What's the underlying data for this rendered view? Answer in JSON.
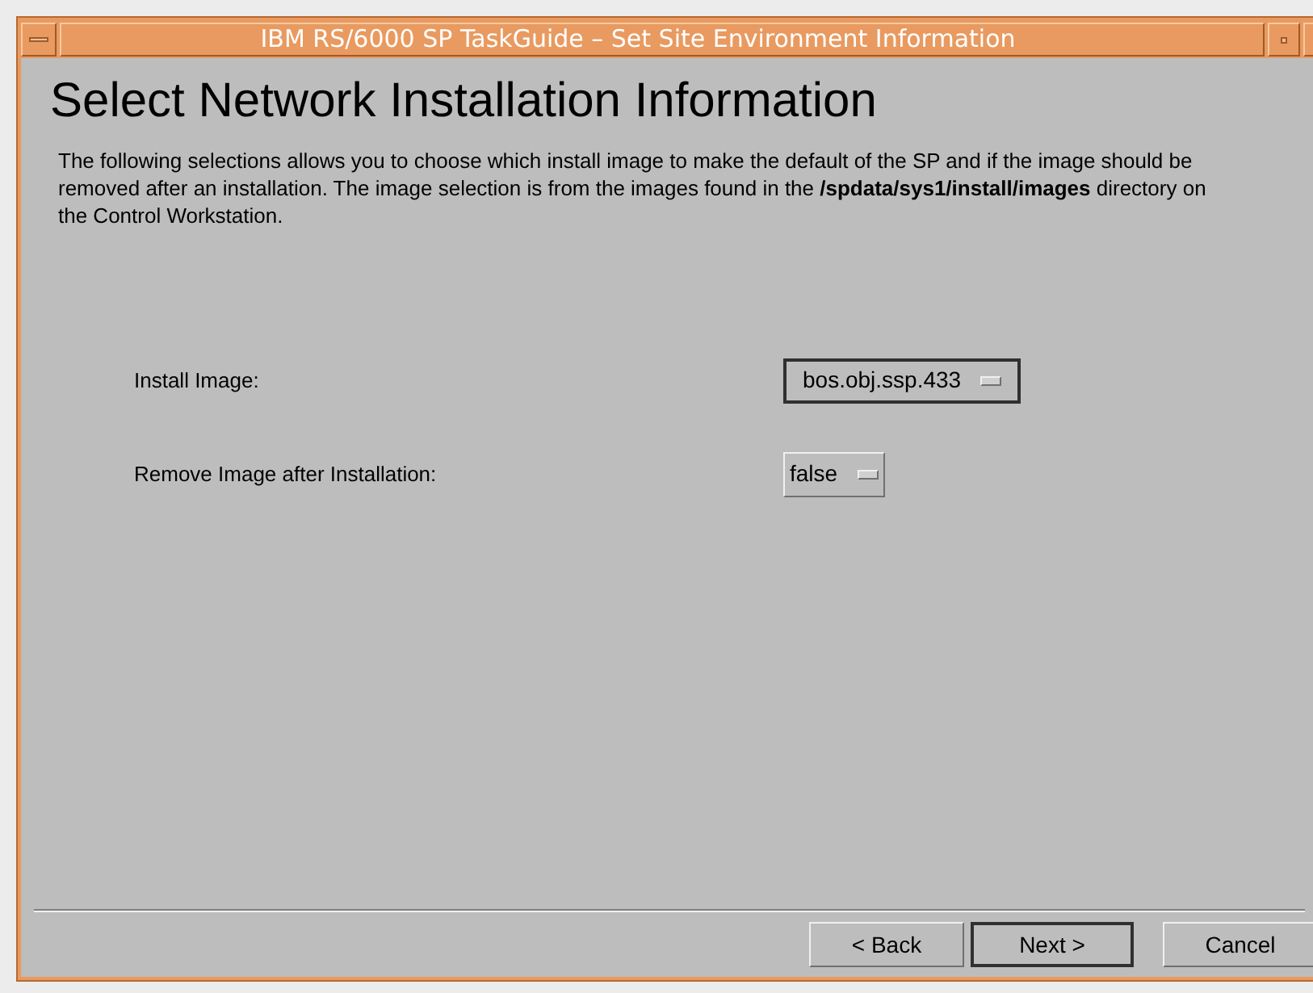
{
  "window": {
    "title": "IBM RS/6000 SP TaskGuide – Set Site Environment Information"
  },
  "heading": "Select Network Installation Information",
  "description": "The following selections allows you to choose which install image to make the default of the SP and if the image should be removed after an installation.  The image selection is from the images found in the **/spdata/sys1/install/images** directory on the Control Workstation.",
  "fields": [
    {
      "label": "Install Image:",
      "value": "bos.obj.ssp.433",
      "focused": true
    },
    {
      "label": "Remove Image after Installation:",
      "value": "false",
      "focused": false
    }
  ],
  "buttons": [
    {
      "label": "< Back",
      "default": false
    },
    {
      "label": "Next >",
      "default": true
    },
    {
      "label": "Cancel",
      "default": false
    }
  ]
}
